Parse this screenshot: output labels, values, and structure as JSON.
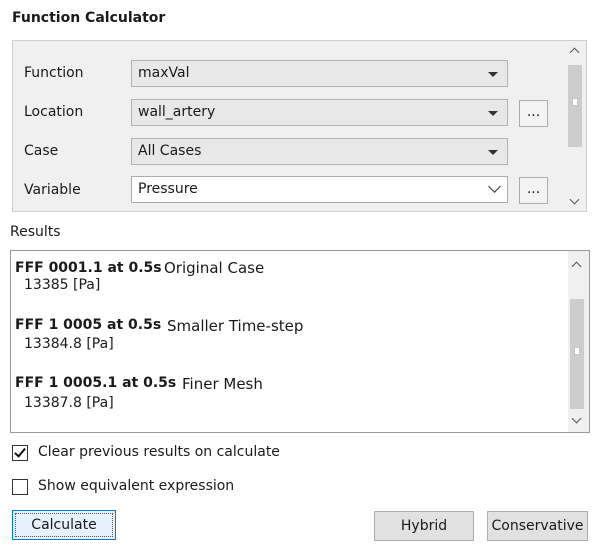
{
  "panel": {
    "title": "Function Calculator"
  },
  "params": {
    "function": {
      "label": "Function",
      "value": "maxVal"
    },
    "location": {
      "label": "Location",
      "value": "wall_artery",
      "browse_label": "..."
    },
    "case": {
      "label": "Case",
      "value": "All Cases"
    },
    "variable": {
      "label": "Variable",
      "value": "Pressure",
      "browse_label": "..."
    }
  },
  "results": {
    "label": "Results",
    "entries": [
      {
        "name": "FFF 0001.1 at 0.5s",
        "note": "Original Case",
        "value": "13385 [Pa]"
      },
      {
        "name": "FFF 1 0005 at 0.5s",
        "note": "Smaller Time-step",
        "value": "13384.8 [Pa]"
      },
      {
        "name": "FFF 1 0005.1 at 0.5s",
        "note": "Finer Mesh",
        "value": "13387.8 [Pa]"
      }
    ]
  },
  "options": {
    "clear_previous": {
      "label": "Clear previous results on calculate",
      "checked": true
    },
    "show_equivalent": {
      "label": "Show equivalent expression",
      "checked": false
    }
  },
  "buttons": {
    "calculate": "Calculate",
    "hybrid": "Hybrid",
    "conservative": "Conservative"
  },
  "icons": {
    "dropdown": "caret-down-icon",
    "variable_dropdown": "chevron-down-icon",
    "scroll_up": "chevron-up-icon",
    "scroll_down": "chevron-down-icon",
    "checkbox": "check-icon"
  },
  "colors": {
    "panel_bg": "#f0f0f0",
    "primary_button_border": "#0078d7",
    "primary_button_bg": "#e5f1fb"
  }
}
